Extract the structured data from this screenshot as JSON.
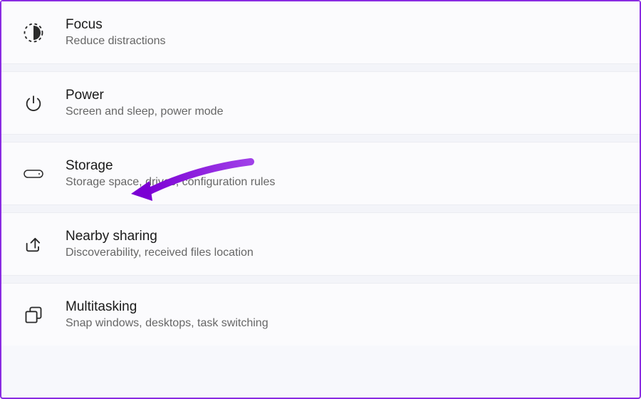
{
  "settings": {
    "items": [
      {
        "key": "focus",
        "title": "Focus",
        "subtitle": "Reduce distractions",
        "icon": "focus-icon"
      },
      {
        "key": "power",
        "title": "Power",
        "subtitle": "Screen and sleep, power mode",
        "icon": "power-icon"
      },
      {
        "key": "storage",
        "title": "Storage",
        "subtitle": "Storage space, drives, configuration rules",
        "icon": "storage-icon"
      },
      {
        "key": "nearby-sharing",
        "title": "Nearby sharing",
        "subtitle": "Discoverability, received files location",
        "icon": "share-icon"
      },
      {
        "key": "multitasking",
        "title": "Multitasking",
        "subtitle": "Snap windows, desktops, task switching",
        "icon": "multitask-icon"
      }
    ]
  },
  "annotation": {
    "target": "storage",
    "color": "#7b00d4"
  }
}
